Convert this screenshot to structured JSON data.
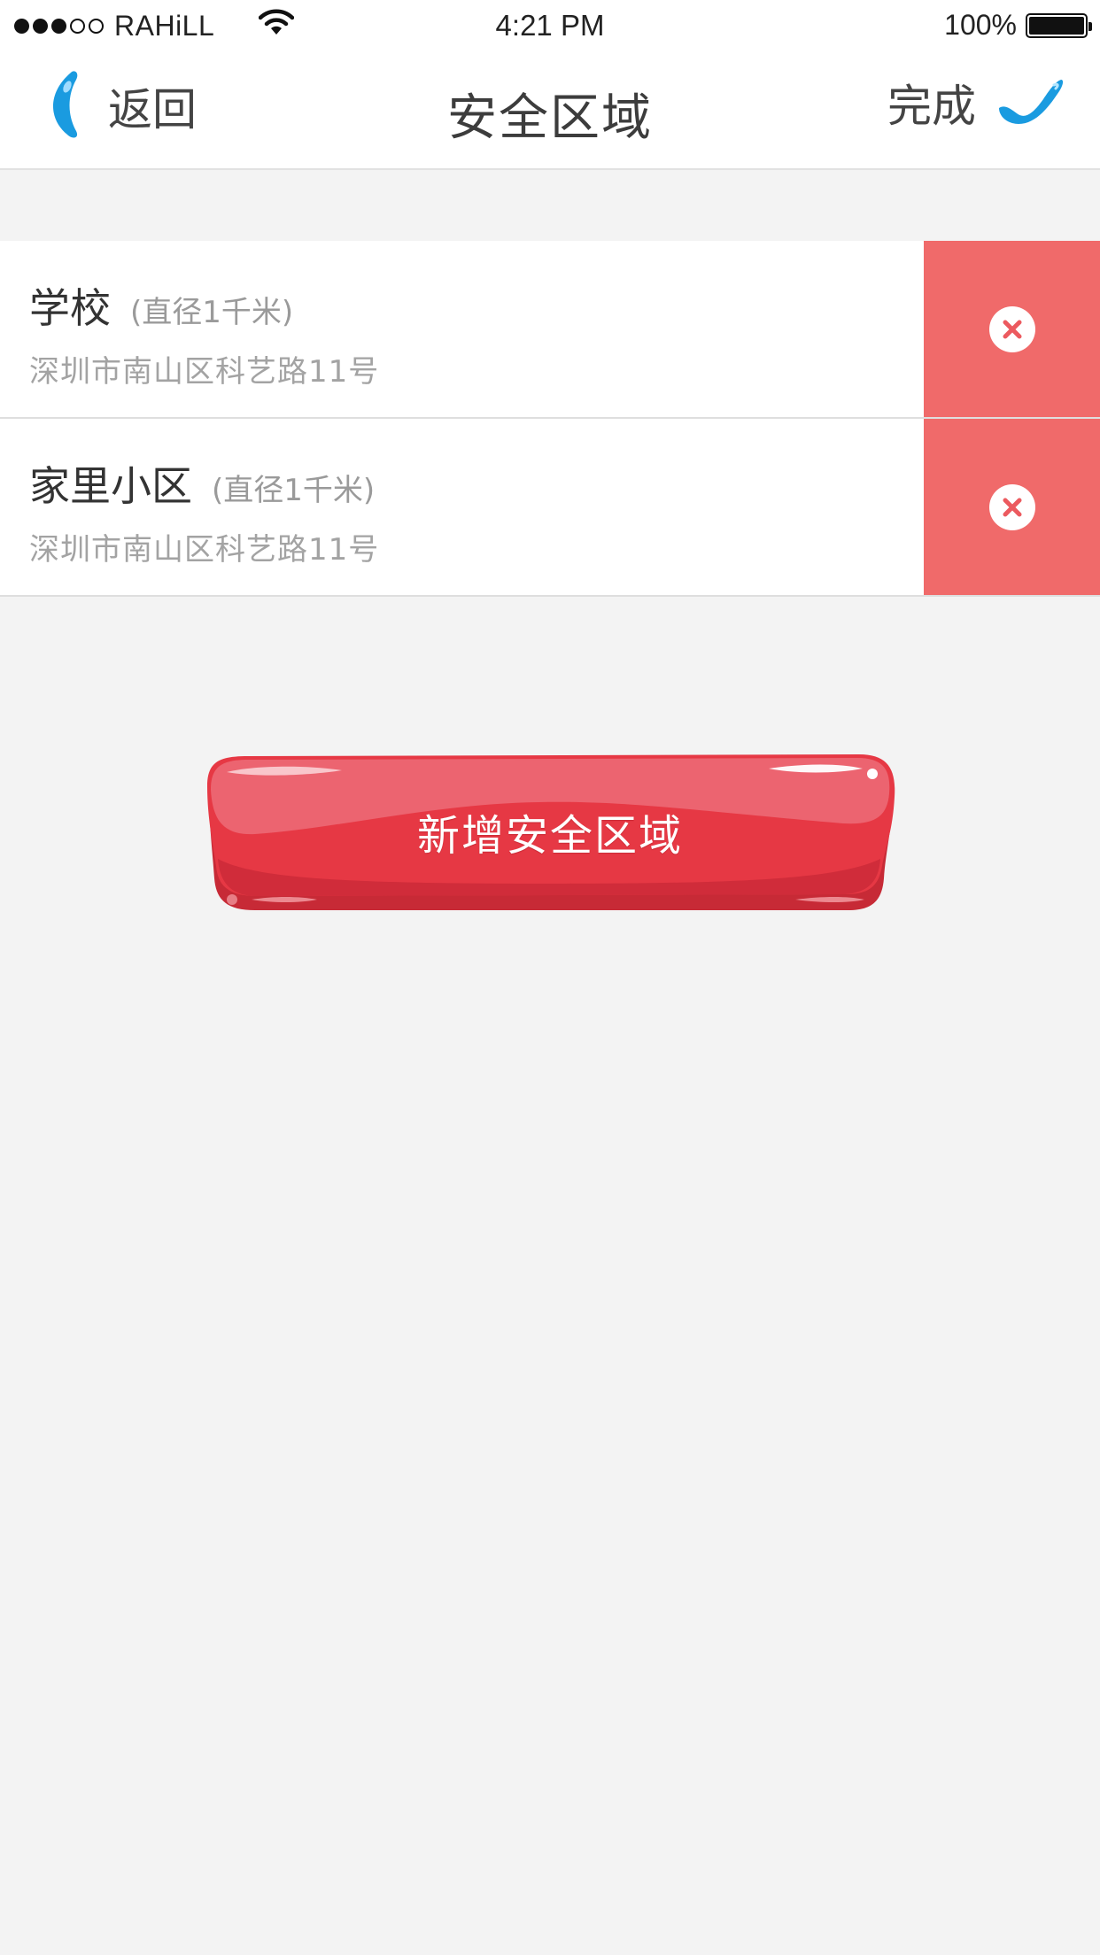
{
  "status_bar": {
    "carrier": "RAHiLL",
    "time": "4:21 PM",
    "battery": "100%",
    "signal_bars": 3,
    "signal_total": 5,
    "battery_level": 1.0
  },
  "nav": {
    "back_label": "返回",
    "title": "安全区域",
    "done_label": "完成"
  },
  "zones": [
    {
      "name": "学校",
      "radius": "(直径1千米)",
      "address": "深圳市南山区科艺路11号"
    },
    {
      "name": "家里小区",
      "radius": "(直径1千米)",
      "address": "深圳市南山区科艺路11号"
    }
  ],
  "add_button": {
    "label": "新增安全区域"
  },
  "colors": {
    "accent_blue": "#1a9be0",
    "delete_red": "#f06a6a",
    "button_red": "#e63844",
    "background": "#f3f3f3"
  },
  "icons": {
    "back": "blue-drop-back-icon",
    "done": "blue-check-icon",
    "delete": "close-circle-icon",
    "wifi": "wifi-icon",
    "battery": "battery-icon"
  }
}
